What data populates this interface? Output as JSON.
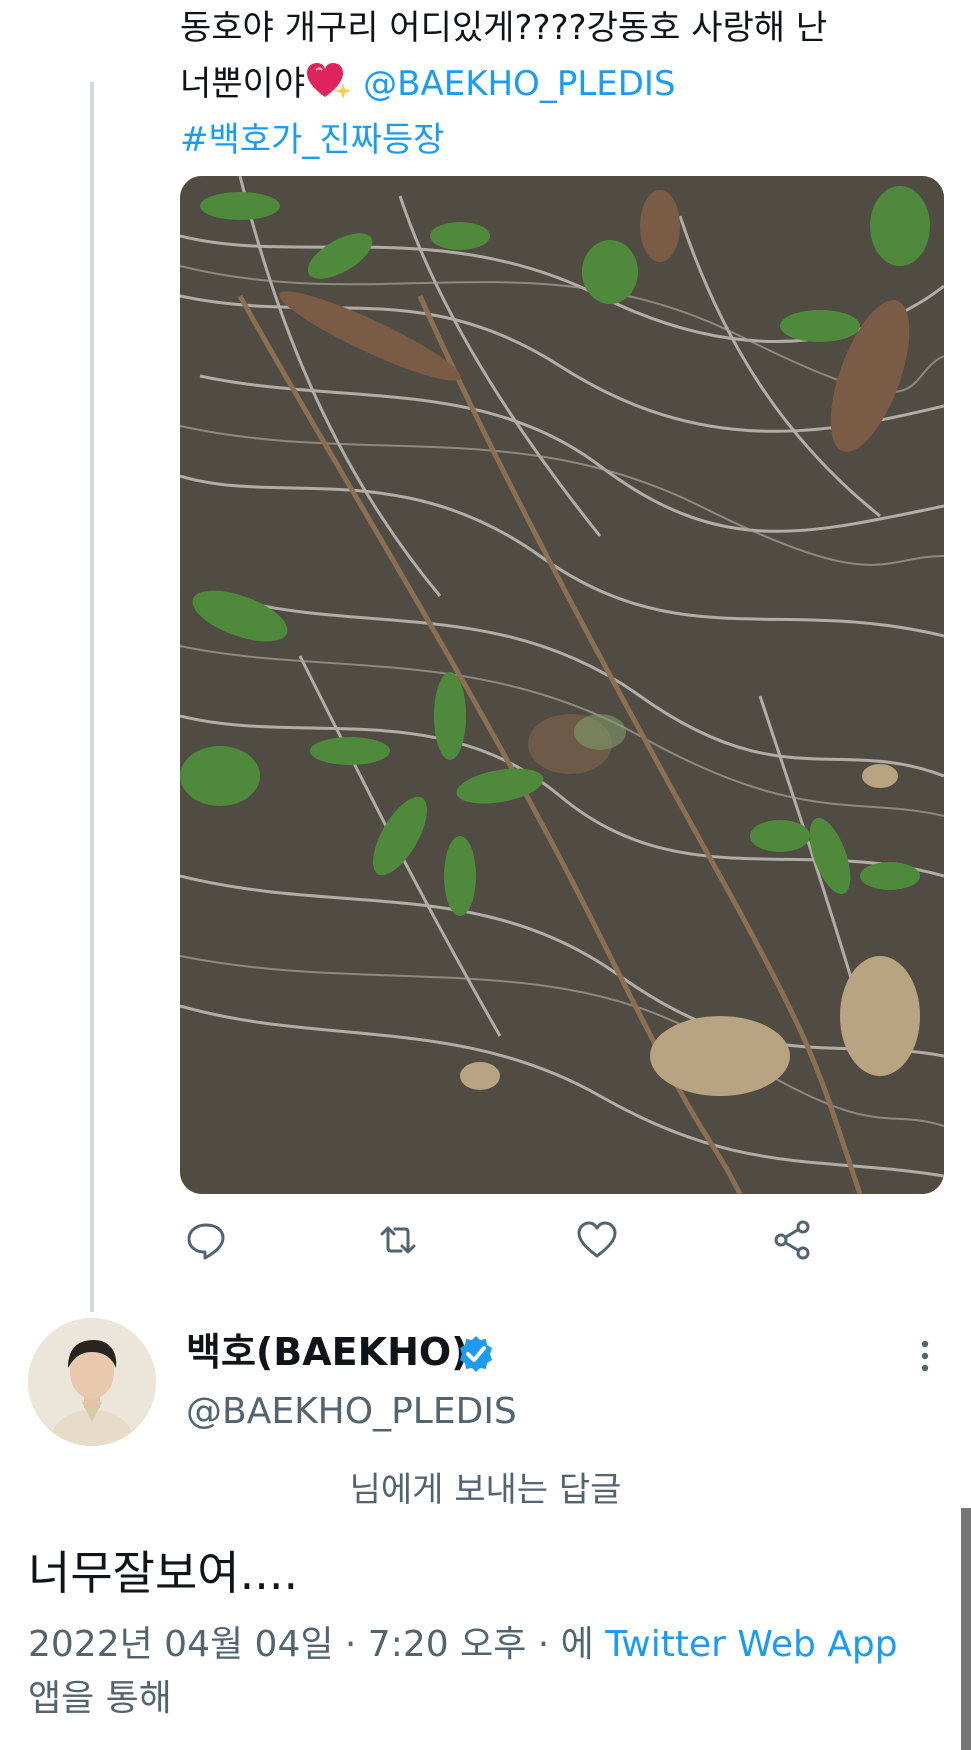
{
  "tweet": {
    "text_line1": "동호야 개구리 어디있게????강동호 사랑해 난",
    "text_line2_prefix": "너뿐이야",
    "mention": "@BAEKHO_PLEDIS",
    "hashtag": "#백호가_진짜등장",
    "emoji_icon": "sparkling-heart-icon",
    "media_icon": "photo-frog-in-grass"
  },
  "actions": [
    {
      "name": "reply",
      "icon": "reply-icon"
    },
    {
      "name": "retweet",
      "icon": "retweet-icon"
    },
    {
      "name": "like",
      "icon": "heart-icon"
    },
    {
      "name": "share",
      "icon": "share-icon"
    }
  ],
  "reply_tweet": {
    "display_name": "백호(BAEKHO)",
    "verified_icon": "verified-badge-icon",
    "handle": "@BAEKHO_PLEDIS",
    "reply_context": "님에게 보내는 답글",
    "body": "너무잘보여....",
    "timestamp": "2022년 04월 04일 · 7:20 오후 · 에",
    "source_app": "Twitter Web App",
    "source_suffix": "앱을 통해"
  },
  "colors": {
    "accent": "#1d9bf0",
    "text_primary": "#0f1419",
    "text_secondary": "#536471",
    "thread_line": "#cfd9de"
  }
}
